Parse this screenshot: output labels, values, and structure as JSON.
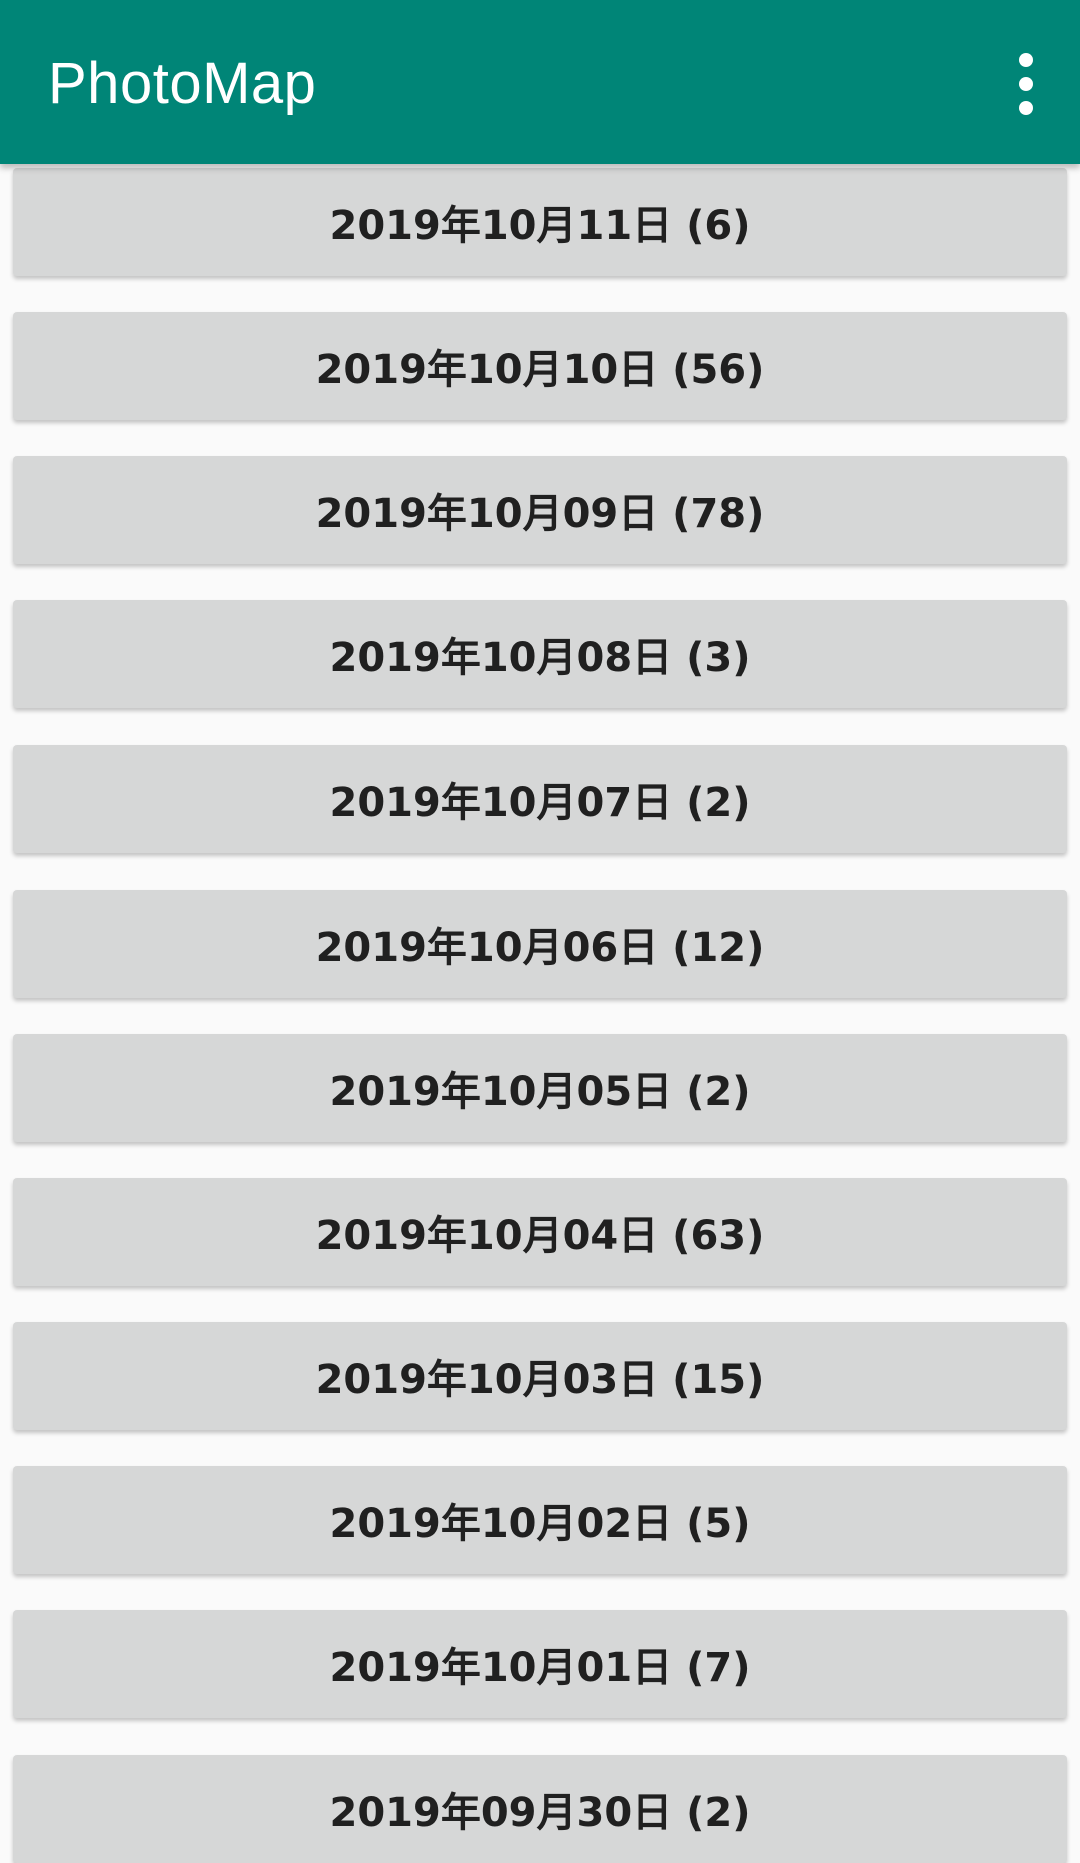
{
  "appbar": {
    "title": "PhotoMap",
    "menu_icon": "more-vert-icon",
    "background_color": "#008577"
  },
  "dates": [
    {
      "label": "2019年10月11日 (6)"
    },
    {
      "label": "2019年10月10日 (56)"
    },
    {
      "label": "2019年10月09日 (78)"
    },
    {
      "label": "2019年10月08日 (3)"
    },
    {
      "label": "2019年10月07日 (2)"
    },
    {
      "label": "2019年10月06日 (12)"
    },
    {
      "label": "2019年10月05日 (2)"
    },
    {
      "label": "2019年10月04日 (63)"
    },
    {
      "label": "2019年10月03日 (15)"
    },
    {
      "label": "2019年10月02日 (5)"
    },
    {
      "label": "2019年10月01日 (7)"
    },
    {
      "label": "2019年09月30日 (2)"
    }
  ]
}
